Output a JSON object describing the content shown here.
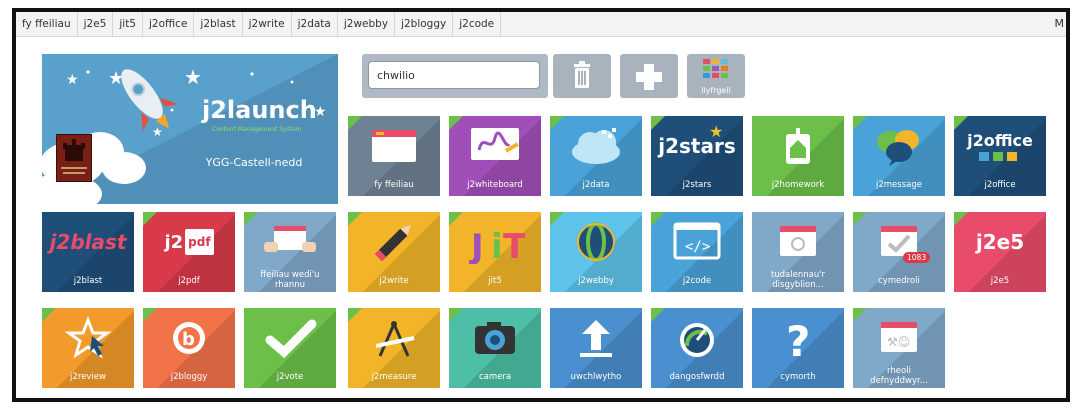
{
  "nav": [
    "fy ffeiliau",
    "j2e5",
    "jit5",
    "j2office",
    "j2blast",
    "j2write",
    "j2data",
    "j2webby",
    "j2bloggy",
    "j2code"
  ],
  "nav_right": "M",
  "launch": {
    "title": "j2launch",
    "subtitle": "Content Management System",
    "school": "YGG-Castell-nedd"
  },
  "search": {
    "value": "chwilio"
  },
  "library_label": "llyfrgell",
  "tiles": [
    "fy ffeiliau",
    "j2whiteboard",
    "j2data",
    "j2stars",
    "j2homework",
    "j2message",
    "j2office",
    "j2blast",
    "j2pdf",
    "ffeiliau wedi'u rhannu",
    "j2write",
    "jit5",
    "j2webby",
    "j2code",
    "tudalennau'r disgyblion...",
    "cymedroli",
    "j2e5",
    "j2review",
    "j2bloggy",
    "j2vote",
    "j2measure",
    "camera",
    "uwchlwytho",
    "dangosfwrdd",
    "cymorth",
    "rheoli defnyddwyr..."
  ],
  "badge": "1083",
  "logo_text": {
    "j2stars": "j2stars",
    "j2office": "j2office",
    "j2blast": "j2blast",
    "j2e5": "j2e5",
    "j2pdf_a": "j2",
    "j2pdf_b": "pdf"
  }
}
